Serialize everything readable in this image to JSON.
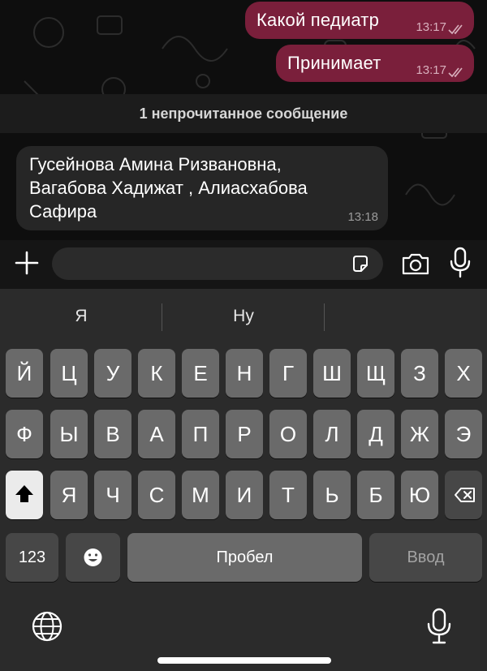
{
  "messages": [
    {
      "direction": "out",
      "text": "Какой педиатр",
      "time": "13:17"
    },
    {
      "direction": "out",
      "text": "Принимает",
      "time": "13:17"
    }
  ],
  "unread_banner": "1 непрочитанное сообщение",
  "incoming": {
    "lines": [
      "Гусейнова Амина Ризвановна,",
      "Вагабова Хадижат , Алиасхабова",
      "Сафира"
    ],
    "time": "13:18"
  },
  "composer": {
    "placeholder": ""
  },
  "keyboard": {
    "suggestions": [
      "Я",
      "Ну",
      ""
    ],
    "row1": [
      "Й",
      "Ц",
      "У",
      "К",
      "Е",
      "Н",
      "Г",
      "Ш",
      "Щ",
      "З",
      "Х"
    ],
    "row2": [
      "Ф",
      "Ы",
      "В",
      "А",
      "П",
      "Р",
      "О",
      "Л",
      "Д",
      "Ж",
      "Э"
    ],
    "row3": [
      "Я",
      "Ч",
      "С",
      "М",
      "И",
      "Т",
      "Ь",
      "Б",
      "Ю"
    ],
    "numbers_label": "123",
    "space_label": "Пробел",
    "return_label": "Ввод"
  },
  "icons": [
    "plus-icon",
    "sticker-icon",
    "camera-icon",
    "microphone-icon",
    "shift-icon",
    "backspace-icon",
    "emoji-icon",
    "globe-icon",
    "dictation-icon"
  ],
  "colors": {
    "outgoing_bubble": "#7a1f3b",
    "incoming_bubble": "#262626",
    "keyboard_bg": "#2b2b2b"
  }
}
